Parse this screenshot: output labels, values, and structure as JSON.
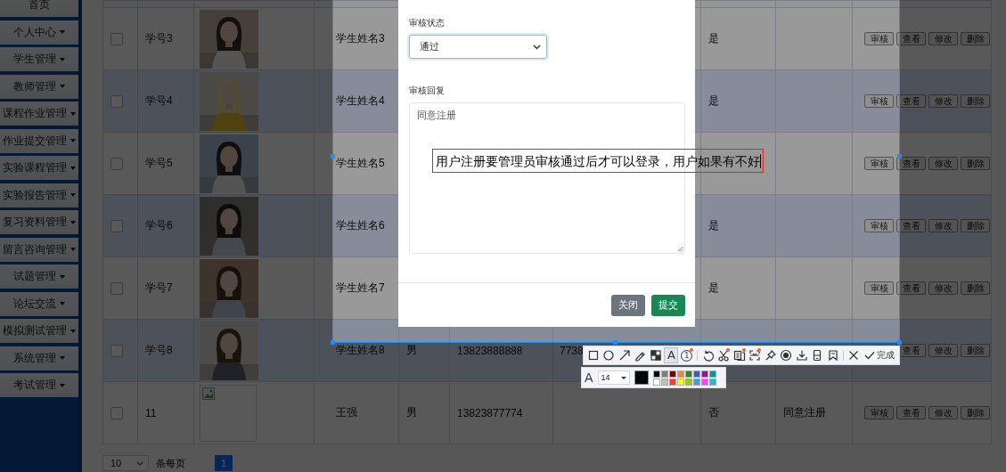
{
  "sidebar": {
    "items": [
      {
        "label": "首页",
        "dropdown": false
      },
      {
        "label": "个人中心",
        "dropdown": true
      },
      {
        "label": "学生管理",
        "dropdown": true
      },
      {
        "label": "教师管理",
        "dropdown": true
      },
      {
        "label": "课程作业管理",
        "dropdown": true
      },
      {
        "label": "作业提交管理",
        "dropdown": true
      },
      {
        "label": "实验课程管理",
        "dropdown": true
      },
      {
        "label": "实验报告管理",
        "dropdown": true
      },
      {
        "label": "复习资料管理",
        "dropdown": true
      },
      {
        "label": "留言咨询管理",
        "dropdown": true
      },
      {
        "label": "试题管理",
        "dropdown": true
      },
      {
        "label": "论坛交流",
        "dropdown": true
      },
      {
        "label": "模拟测试管理",
        "dropdown": true
      },
      {
        "label": "系统管理",
        "dropdown": true
      },
      {
        "label": "考试管理",
        "dropdown": true
      }
    ]
  },
  "table": {
    "rows": [
      {
        "checked": false,
        "column_2": "学号3",
        "column_3": {
          "kind": "picture"
        },
        "column_4": "学生姓名3",
        "column_8": "是",
        "actions": [
          "审核",
          "查看",
          "修改",
          "删除"
        ]
      },
      {
        "checked": false,
        "column_2": "学号4",
        "column_3": {
          "kind": "picture"
        },
        "column_4": "学生姓名4",
        "column_8": "是",
        "actions": [
          "审核",
          "查看",
          "修改",
          "删除"
        ]
      },
      {
        "checked": false,
        "column_2": "学号5",
        "column_3": {
          "kind": "picture"
        },
        "column_4": "学生姓名5",
        "actions": [
          "审核",
          "查看",
          "修改",
          "删除"
        ]
      },
      {
        "checked": false,
        "column_2": "学号6",
        "column_3": {
          "kind": "picture"
        },
        "column_4": "学生姓名6",
        "column_8": "是",
        "actions": [
          "审核",
          "查看",
          "修改",
          "删除"
        ]
      },
      {
        "checked": false,
        "column_2": "学号7",
        "column_3": {
          "kind": "picture"
        },
        "column_4": "学生姓名7",
        "column_8": "是",
        "actions": [
          "审核",
          "查看",
          "修改",
          "删除"
        ]
      },
      {
        "checked": false,
        "column_2": "学号8",
        "column_3": {
          "kind": "picture"
        },
        "column_4": "学生姓名8",
        "column_5": "男",
        "column_6": "13823888888",
        "column_7": "7738",
        "actions": [
          "查看",
          "修改",
          "删除"
        ]
      },
      {
        "checked": false,
        "column_2": "11",
        "column_3": {
          "kind": "broken"
        },
        "column_4": "王强",
        "column_5": "男",
        "column_6": "13823877774",
        "column_8": "否",
        "column_9": "同意注册",
        "actions": [
          "审核",
          "查看",
          "修改",
          "删除"
        ]
      }
    ]
  },
  "pagination": {
    "page_size": "10",
    "per_page_label": "条每页",
    "pages": [
      {
        "label": "1",
        "selected": true
      }
    ]
  },
  "modal": {
    "fields": [
      {
        "kind": "select",
        "label": "审核状态",
        "value": "通过"
      },
      {
        "kind": "textarea",
        "label": "审核回复",
        "value": "同意注册"
      }
    ],
    "buttons": [
      {
        "label": "关闭",
        "kind": "secondary"
      },
      {
        "label": "提交",
        "kind": "primary"
      }
    ]
  },
  "capture": {
    "annotation": {
      "text": "用户注册要管理员审核通过后才可以登录，用户如果有不好"
    },
    "toolbar": {
      "groups": [
        [
          {
            "kind": "rectangle",
            "selected": false,
            "dot": false
          },
          {
            "kind": "ellipse",
            "selected": false,
            "dot": false
          },
          {
            "kind": "arrow",
            "selected": false,
            "dot": false
          },
          {
            "kind": "pencil",
            "selected": false,
            "dot": false
          },
          {
            "kind": "mosaic",
            "selected": false,
            "dot": false
          },
          {
            "kind": "text",
            "glyph": "A",
            "selected": true,
            "dot": false
          },
          {
            "kind": "number",
            "glyph": "1",
            "selected": false,
            "dot": true
          }
        ],
        [
          {
            "kind": "undo",
            "selected": false,
            "dot": false
          },
          {
            "kind": "scissors",
            "selected": false,
            "dot": true
          },
          {
            "kind": "ocr",
            "selected": false,
            "dot": true
          },
          {
            "kind": "scan",
            "selected": false,
            "dot": true
          },
          {
            "kind": "pin",
            "selected": false,
            "dot": false
          },
          {
            "kind": "record",
            "selected": false,
            "dot": false
          },
          {
            "kind": "download",
            "selected": false,
            "dot": false
          },
          {
            "kind": "phone",
            "selected": false,
            "dot": false
          },
          {
            "kind": "bookmark",
            "selected": false,
            "dot": false
          }
        ],
        [
          {
            "kind": "close",
            "selected": false,
            "dot": false
          }
        ]
      ],
      "done": "完成"
    },
    "style_bar": {
      "font_glyph": "A",
      "size": "14",
      "current_swatch": {
        "color": "#000000"
      },
      "palette": [
        {
          "color": "#000000"
        },
        {
          "color": "#808080"
        },
        {
          "color": "#800000"
        },
        {
          "color": "#f7883a"
        },
        {
          "color": "#308430"
        },
        {
          "color": "#385ad3"
        },
        {
          "color": "#9c0d9c"
        },
        {
          "color": "#009999"
        },
        {
          "color": "#ffffff"
        },
        {
          "color": "#c0c0c0"
        },
        {
          "color": "#fb3838"
        },
        {
          "color": "#ffff00"
        },
        {
          "color": "#99cc00"
        },
        {
          "color": "#3d9ee5"
        },
        {
          "color": "#ff40ff"
        },
        {
          "color": "#1bbdd6"
        }
      ]
    }
  }
}
